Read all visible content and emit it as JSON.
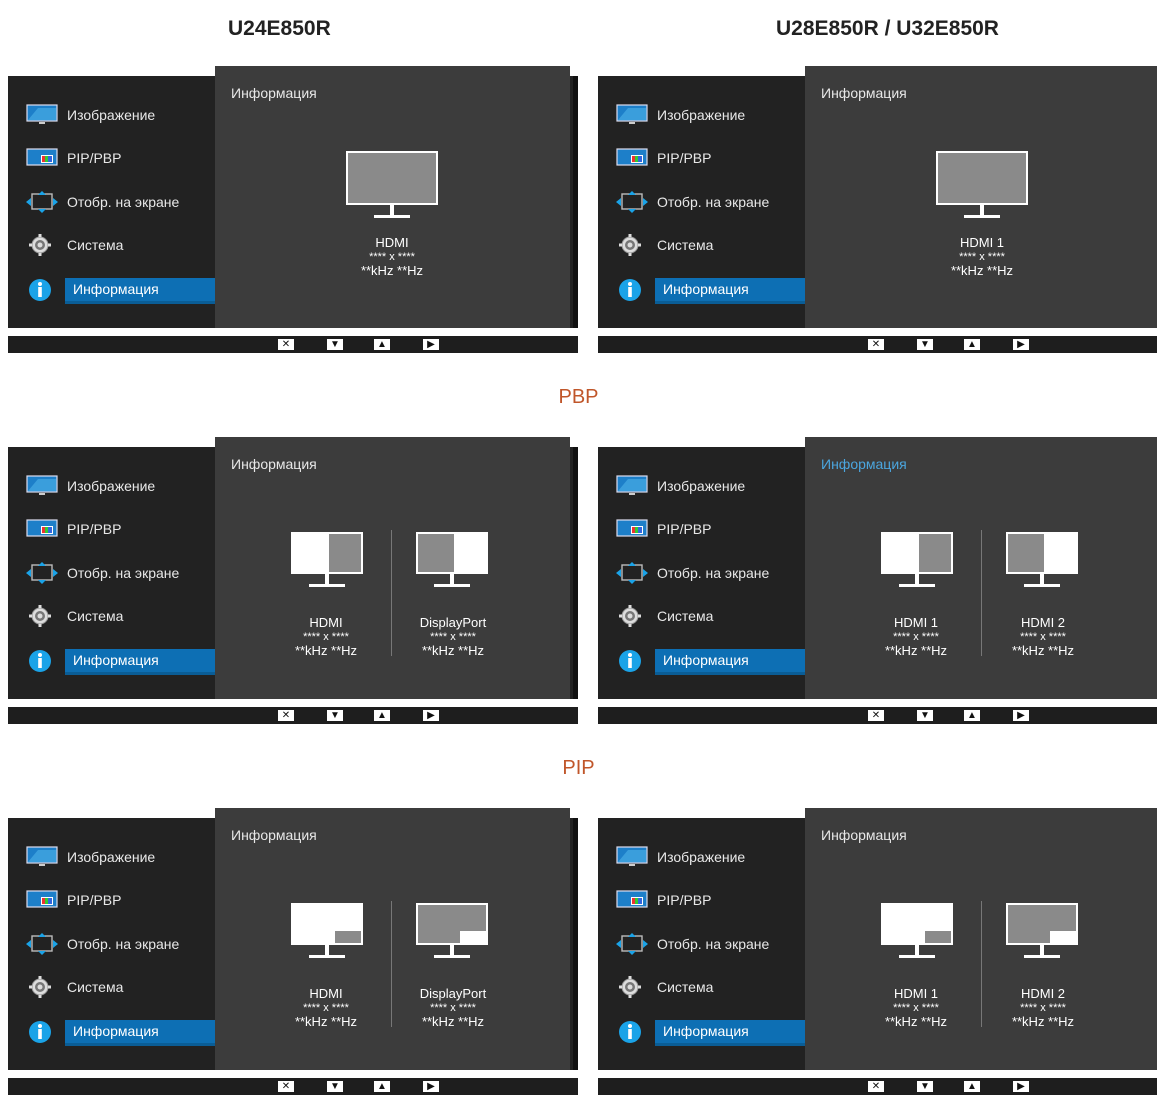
{
  "headers": {
    "left_model": "U24E850R",
    "right_model": "U28E850R / U32E850R",
    "pbp_title": "PBP",
    "pip_title": "PIP"
  },
  "menu": {
    "items": [
      "Изображение",
      "PIP/PBP",
      "Отобр. на экране",
      "Система",
      "Информация"
    ],
    "icons": [
      "monitor-icon",
      "pip-pbp-icon",
      "screen-position-icon",
      "gear-icon",
      "info-icon"
    ],
    "active_index": 4
  },
  "content_title": "Информация",
  "resolution": "**** x ****",
  "frequency": "**kHz **Hz",
  "sources": {
    "left_single": "HDMI",
    "right_single": "HDMI 1",
    "left_a": "HDMI",
    "left_b": "DisplayPort",
    "right_a": "HDMI 1",
    "right_b": "HDMI 2"
  },
  "bottom_buttons": [
    "close-icon",
    "arrow-down-icon",
    "arrow-up-icon",
    "arrow-right-icon"
  ],
  "colors": {
    "active": "#0d6fb4",
    "section_title": "#c0562a",
    "highlighted_title": "#4ba6df"
  }
}
